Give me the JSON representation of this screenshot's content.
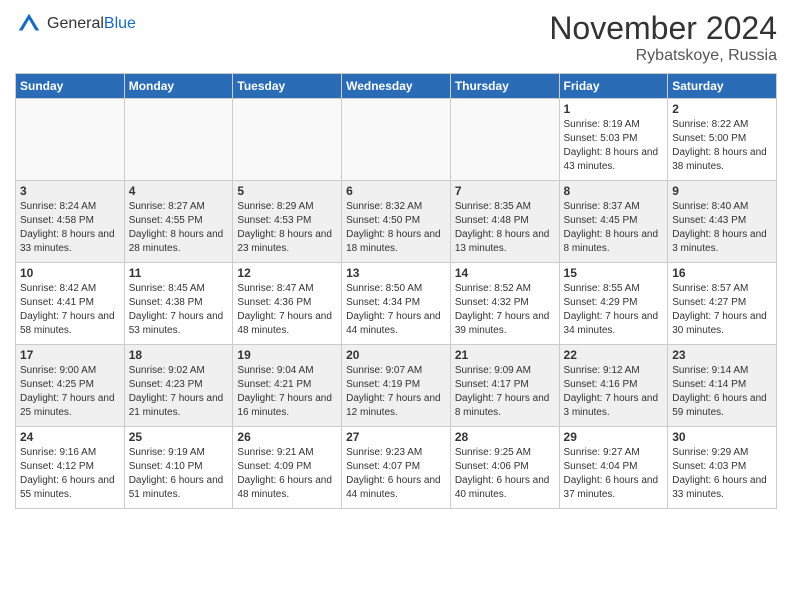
{
  "header": {
    "logo_general": "General",
    "logo_blue": "Blue",
    "month_title": "November 2024",
    "location": "Rybatskoye, Russia"
  },
  "days_of_week": [
    "Sunday",
    "Monday",
    "Tuesday",
    "Wednesday",
    "Thursday",
    "Friday",
    "Saturday"
  ],
  "weeks": [
    {
      "days": [
        {
          "num": "",
          "info": ""
        },
        {
          "num": "",
          "info": ""
        },
        {
          "num": "",
          "info": ""
        },
        {
          "num": "",
          "info": ""
        },
        {
          "num": "",
          "info": ""
        },
        {
          "num": "1",
          "info": "Sunrise: 8:19 AM\nSunset: 5:03 PM\nDaylight: 8 hours and 43 minutes."
        },
        {
          "num": "2",
          "info": "Sunrise: 8:22 AM\nSunset: 5:00 PM\nDaylight: 8 hours and 38 minutes."
        }
      ]
    },
    {
      "days": [
        {
          "num": "3",
          "info": "Sunrise: 8:24 AM\nSunset: 4:58 PM\nDaylight: 8 hours and 33 minutes."
        },
        {
          "num": "4",
          "info": "Sunrise: 8:27 AM\nSunset: 4:55 PM\nDaylight: 8 hours and 28 minutes."
        },
        {
          "num": "5",
          "info": "Sunrise: 8:29 AM\nSunset: 4:53 PM\nDaylight: 8 hours and 23 minutes."
        },
        {
          "num": "6",
          "info": "Sunrise: 8:32 AM\nSunset: 4:50 PM\nDaylight: 8 hours and 18 minutes."
        },
        {
          "num": "7",
          "info": "Sunrise: 8:35 AM\nSunset: 4:48 PM\nDaylight: 8 hours and 13 minutes."
        },
        {
          "num": "8",
          "info": "Sunrise: 8:37 AM\nSunset: 4:45 PM\nDaylight: 8 hours and 8 minutes."
        },
        {
          "num": "9",
          "info": "Sunrise: 8:40 AM\nSunset: 4:43 PM\nDaylight: 8 hours and 3 minutes."
        }
      ]
    },
    {
      "days": [
        {
          "num": "10",
          "info": "Sunrise: 8:42 AM\nSunset: 4:41 PM\nDaylight: 7 hours and 58 minutes."
        },
        {
          "num": "11",
          "info": "Sunrise: 8:45 AM\nSunset: 4:38 PM\nDaylight: 7 hours and 53 minutes."
        },
        {
          "num": "12",
          "info": "Sunrise: 8:47 AM\nSunset: 4:36 PM\nDaylight: 7 hours and 48 minutes."
        },
        {
          "num": "13",
          "info": "Sunrise: 8:50 AM\nSunset: 4:34 PM\nDaylight: 7 hours and 44 minutes."
        },
        {
          "num": "14",
          "info": "Sunrise: 8:52 AM\nSunset: 4:32 PM\nDaylight: 7 hours and 39 minutes."
        },
        {
          "num": "15",
          "info": "Sunrise: 8:55 AM\nSunset: 4:29 PM\nDaylight: 7 hours and 34 minutes."
        },
        {
          "num": "16",
          "info": "Sunrise: 8:57 AM\nSunset: 4:27 PM\nDaylight: 7 hours and 30 minutes."
        }
      ]
    },
    {
      "days": [
        {
          "num": "17",
          "info": "Sunrise: 9:00 AM\nSunset: 4:25 PM\nDaylight: 7 hours and 25 minutes."
        },
        {
          "num": "18",
          "info": "Sunrise: 9:02 AM\nSunset: 4:23 PM\nDaylight: 7 hours and 21 minutes."
        },
        {
          "num": "19",
          "info": "Sunrise: 9:04 AM\nSunset: 4:21 PM\nDaylight: 7 hours and 16 minutes."
        },
        {
          "num": "20",
          "info": "Sunrise: 9:07 AM\nSunset: 4:19 PM\nDaylight: 7 hours and 12 minutes."
        },
        {
          "num": "21",
          "info": "Sunrise: 9:09 AM\nSunset: 4:17 PM\nDaylight: 7 hours and 8 minutes."
        },
        {
          "num": "22",
          "info": "Sunrise: 9:12 AM\nSunset: 4:16 PM\nDaylight: 7 hours and 3 minutes."
        },
        {
          "num": "23",
          "info": "Sunrise: 9:14 AM\nSunset: 4:14 PM\nDaylight: 6 hours and 59 minutes."
        }
      ]
    },
    {
      "days": [
        {
          "num": "24",
          "info": "Sunrise: 9:16 AM\nSunset: 4:12 PM\nDaylight: 6 hours and 55 minutes."
        },
        {
          "num": "25",
          "info": "Sunrise: 9:19 AM\nSunset: 4:10 PM\nDaylight: 6 hours and 51 minutes."
        },
        {
          "num": "26",
          "info": "Sunrise: 9:21 AM\nSunset: 4:09 PM\nDaylight: 6 hours and 48 minutes."
        },
        {
          "num": "27",
          "info": "Sunrise: 9:23 AM\nSunset: 4:07 PM\nDaylight: 6 hours and 44 minutes."
        },
        {
          "num": "28",
          "info": "Sunrise: 9:25 AM\nSunset: 4:06 PM\nDaylight: 6 hours and 40 minutes."
        },
        {
          "num": "29",
          "info": "Sunrise: 9:27 AM\nSunset: 4:04 PM\nDaylight: 6 hours and 37 minutes."
        },
        {
          "num": "30",
          "info": "Sunrise: 9:29 AM\nSunset: 4:03 PM\nDaylight: 6 hours and 33 minutes."
        }
      ]
    }
  ]
}
